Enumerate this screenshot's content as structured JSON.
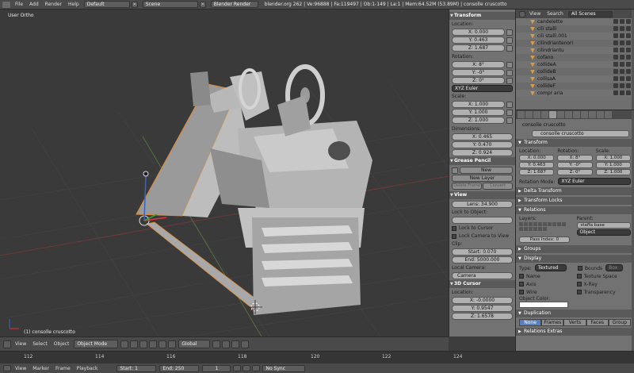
{
  "topbar": {
    "menus": [
      "File",
      "Add",
      "Render",
      "Help"
    ],
    "layout": "Default",
    "scene": "Scene",
    "engine": "Blender Render",
    "info": "blender.org 262 | Ve:96888 | Fa:119497 | Ob:1-149 | La:1 | Mem:64.52M (53.89M) | consolle cruscotto"
  },
  "viewport": {
    "view_label": "User Ortho",
    "object_label": "(1) consolle cruscotto"
  },
  "viewport_header": {
    "menus": [
      "View",
      "Select",
      "Object"
    ],
    "mode": "Object Mode",
    "pivot": "Global"
  },
  "timeline": {
    "ruler": [
      "112",
      "114",
      "116",
      "118",
      "120",
      "122",
      "124"
    ],
    "menus": [
      "View",
      "Marker",
      "Frame",
      "Playback"
    ],
    "start": "Start: 1",
    "end": "End: 250",
    "current": "1",
    "sync": "No Sync"
  },
  "properties_panel": {
    "transform_title": "Transform",
    "location_label": "Location:",
    "location": [
      "X: 0.000",
      "Y: 0.463",
      "Z: 1.687"
    ],
    "rotation_label": "Rotation:",
    "rotation": [
      "X: 8°",
      "Y: -0°",
      "Z: 0°"
    ],
    "rotation_mode": "XYZ Euler",
    "scale_label": "Scale:",
    "scale": [
      "X: 1.000",
      "Y: 1.000",
      "Z: 1.000"
    ],
    "dimensions_label": "Dimensions:",
    "dimensions": [
      "X: 0.465",
      "Y: 0.470",
      "Z: 0.924"
    ],
    "grease_title": "Grease Pencil",
    "new_label": "New",
    "new_layer_label": "New Layer",
    "delete_frame_label": "Delete Frame",
    "convert_label": "Convert",
    "view_title": "View",
    "lens": "Lens: 34.900",
    "lock_to_object": "Lock to Object:",
    "lock_to_cursor": "Lock to Cursor",
    "lock_camera_to_view": "Lock Camera to View",
    "clip_label": "Clip:",
    "clip_start": "Start: 0.070",
    "clip_end": "End: 5000.000",
    "local_camera_label": "Local Camera:",
    "camera": "Camera",
    "cursor_title": "3D Cursor",
    "cursor_location_label": "Location:",
    "cursor": [
      "X: -0.0000",
      "Y: 0.9547",
      "Z: 1.6578"
    ]
  },
  "outliner": {
    "menus": [
      "View",
      "Search"
    ],
    "scene_filter": "All Scenes",
    "items": [
      "candelette",
      "cili stalli",
      "cili stalli.001",
      "cilindriantenori",
      "cilindriantu",
      "cofano",
      "collideA",
      "collideB",
      "collisaA",
      "collideF",
      "compr aria"
    ]
  },
  "object_props": {
    "crumb": "consolle cruscotto",
    "name": "consolle cruscotto",
    "transform_title": "Transform",
    "location_label": "Location:",
    "rotation_label": "Rotation:",
    "scale_label": "Scale:",
    "location": [
      "X: 0.000",
      "Y: 0.463",
      "Z: 1.687"
    ],
    "rotation": [
      "X: 8°",
      "Y: -0°",
      "Z: 0°"
    ],
    "scale": [
      "X: 1.000",
      "Y: 1.000",
      "Z: 1.000"
    ],
    "rotation_mode_label": "Rotation Mode:",
    "rotation_mode": "XYZ Euler",
    "delta_title": "Delta Transform",
    "locks_title": "Transform Locks",
    "relations_title": "Relations",
    "layers_label": "Layers:",
    "parent_label": "Parent:",
    "parent": "staffa base",
    "parent_type": "Object",
    "pass_index": "Pass Index: 0",
    "groups_title": "Groups",
    "display_title": "Display",
    "type_label": "Type:",
    "type_value": "Textured",
    "bounds": "Bounds",
    "bounds_value": "Box",
    "name_check": "Name",
    "texture_space": "Texture Space",
    "axis_check": "Axis",
    "xray": "X-Ray",
    "wire": "Wire",
    "transparency": "Transparency",
    "object_color_label": "Object Color:",
    "duplication_title": "Duplication",
    "dup_options": [
      "None",
      "Frames",
      "Verts",
      "Faces",
      "Group"
    ],
    "relations_extras_title": "Relations Extras"
  }
}
